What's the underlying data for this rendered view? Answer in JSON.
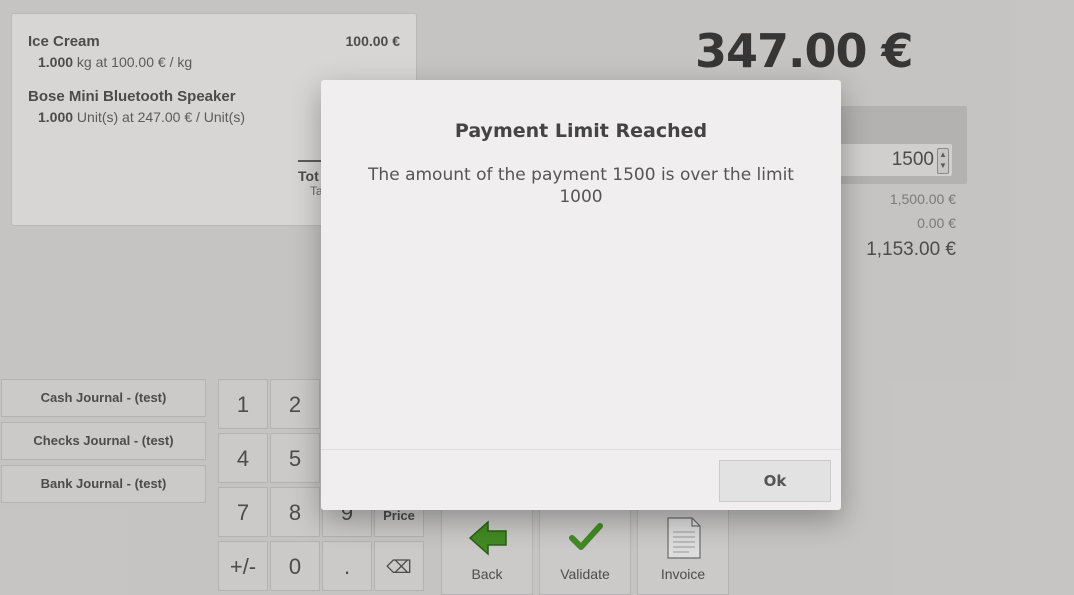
{
  "order": {
    "lines": [
      {
        "name": "Ice Cream",
        "price": "100.00 €",
        "qty": "1.000",
        "info": " kg at 100.00 € / kg"
      },
      {
        "name": "Bose Mini Bluetooth Speaker",
        "price": "",
        "qty": "1.000",
        "info": " Unit(s) at 247.00 € / Unit(s)"
      }
    ],
    "total_label": "Tot",
    "taxes_label": "Ta"
  },
  "payment": {
    "due": "347.00 €",
    "input_value": "1500",
    "tendered": "1,500.00 €",
    "remaining": "0.00 €",
    "change": "1,153.00 €"
  },
  "journals": [
    "Cash Journal - (test)",
    "Checks Journal - (test)",
    "Bank Journal - (test)"
  ],
  "numpad": {
    "k1": "1",
    "k2": "2",
    "k4": "4",
    "k5": "5",
    "k7": "7",
    "k8": "8",
    "k9": "9",
    "price": "Price",
    "plusminus": "+/-",
    "k0": "0",
    "dot": ".",
    "backspace": "⌫"
  },
  "actions": {
    "back": "Back",
    "validate": "Validate",
    "invoice": "Invoice"
  },
  "colors": {
    "back_arrow": "#4a9a28",
    "validate_check": "#4a9a28"
  },
  "modal": {
    "title": "Payment Limit Reached",
    "body": "The amount of the payment 1500 is over the limit 1000",
    "ok": "Ok"
  }
}
